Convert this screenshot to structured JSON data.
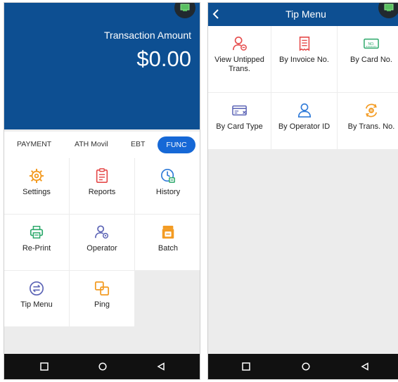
{
  "left": {
    "transaction_label": "Transaction Amount",
    "transaction_amount": "$0.00",
    "tabs": [
      "PAYMENT",
      "ATH Movil",
      "EBT",
      "FUNC"
    ],
    "active_tab": "FUNC",
    "tiles": [
      {
        "label": "Settings",
        "icon": "settings-gear-icon"
      },
      {
        "label": "Reports",
        "icon": "reports-clipboard-icon"
      },
      {
        "label": "History",
        "icon": "history-clock-icon"
      },
      {
        "label": "Re-Print",
        "icon": "printer-icon"
      },
      {
        "label": "Operator",
        "icon": "operator-user-icon"
      },
      {
        "label": "Batch",
        "icon": "batch-stack-icon"
      },
      {
        "label": "Tip Menu",
        "icon": "tip-exchange-icon"
      },
      {
        "label": "Ping",
        "icon": "ping-squares-icon"
      }
    ]
  },
  "right": {
    "title": "Tip Menu",
    "tiles": [
      {
        "label": "View Untipped Trans.",
        "icon": "user-minus-icon"
      },
      {
        "label": "By Invoice No.",
        "icon": "receipt-icon"
      },
      {
        "label": "By Card No.",
        "icon": "card-number-icon"
      },
      {
        "label": "By Card Type",
        "icon": "card-type-icon"
      },
      {
        "label": "By Operator ID",
        "icon": "operator-id-icon"
      },
      {
        "label": "By Trans. No.",
        "icon": "trans-number-icon"
      }
    ]
  },
  "colors": {
    "primary_blue": "#0d4f92",
    "active_tab": "#1668d6",
    "icon_orange": "#f39b22",
    "icon_red": "#e54b4b",
    "icon_blue": "#2f7ad8",
    "icon_green": "#2ba86a",
    "icon_purple": "#5b63b5"
  },
  "nav": [
    "square-icon",
    "circle-icon",
    "back-triangle-icon"
  ]
}
